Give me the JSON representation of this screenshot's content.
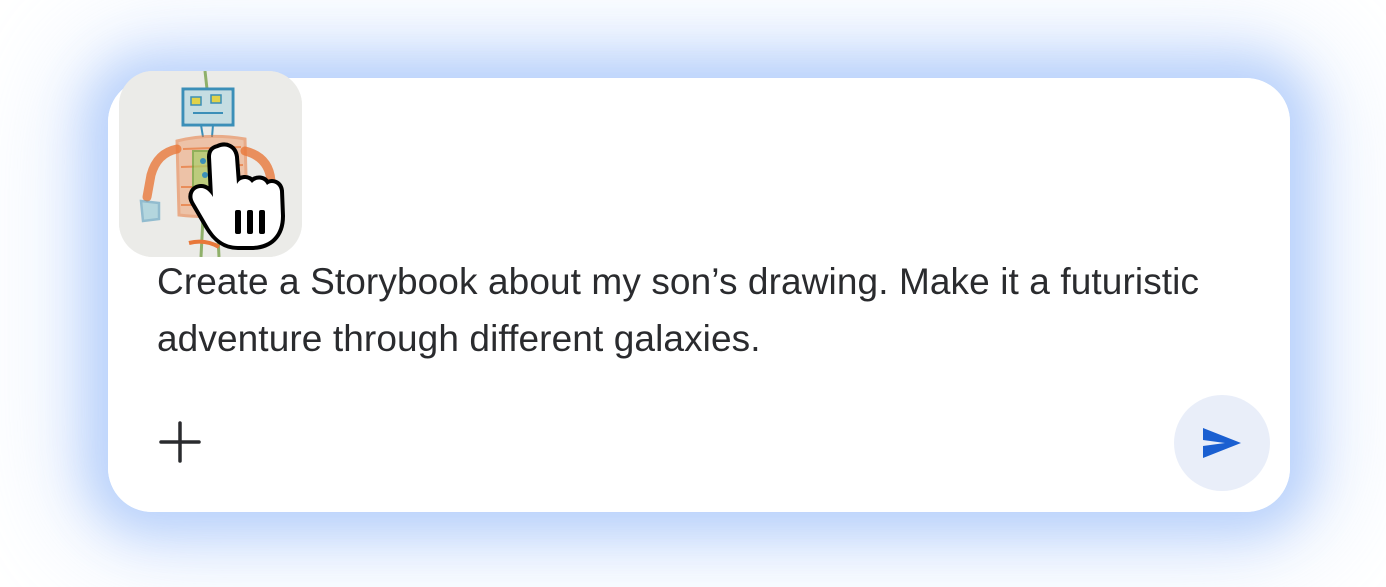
{
  "prompt": {
    "text": "Create a Storybook about my son’s drawing. Make it a futuristic adventure through different galaxies."
  },
  "attachment": {
    "kind": "image",
    "subject": "child's crayon drawing of a robot"
  },
  "icons": {
    "add": "plus-icon",
    "send": "send-arrow-icon",
    "cursor": "hand-pointer-cursor-icon"
  },
  "colors": {
    "send_icon": "#1a5fd1",
    "send_bg": "#e9eef9",
    "glow": "#b2ccfa",
    "text": "#2a2b2e"
  }
}
